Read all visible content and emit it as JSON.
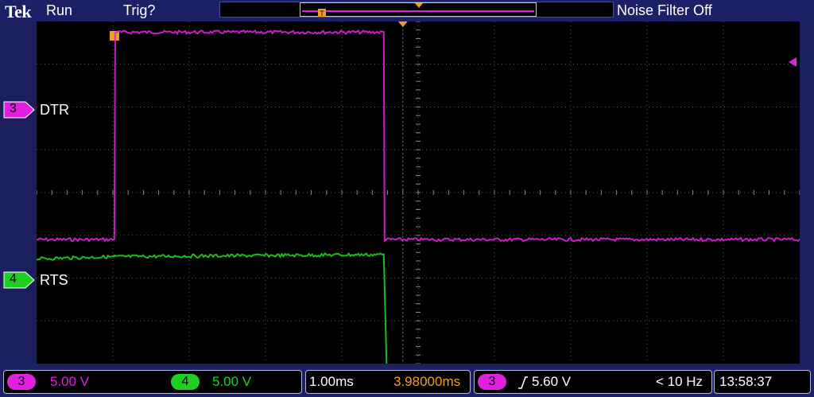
{
  "header": {
    "brand": "Tek",
    "acq_state": "Run",
    "trigger_status": "Trig?",
    "noise_filter": "Noise Filter Off"
  },
  "channels": [
    {
      "number": "3",
      "label": "DTR",
      "color": "#e020e0",
      "scale": "5.00 V"
    },
    {
      "number": "4",
      "label": "RTS",
      "color": "#20d020",
      "scale": "5.00 V"
    }
  ],
  "timebase": {
    "scale": "1.00ms",
    "position": "3.98000ms"
  },
  "trigger": {
    "source": "3",
    "slope_symbol": "/",
    "level": "5.60 V",
    "frequency": "< 10 Hz"
  },
  "clock": "13:58:37",
  "colors": {
    "background": "#1c2066",
    "grid": "#5a5a5a",
    "trigger_marker": "#f0a020",
    "ch3": "#e020e0",
    "ch4": "#20d020"
  },
  "chart_data": {
    "type": "line",
    "xlabel": "",
    "ylabel": "",
    "grid": true,
    "x_divisions": 10,
    "y_divisions": 8,
    "series": [
      {
        "name": "DTR",
        "x_div": [
          0,
          1.02,
          1.03,
          4.55,
          4.56,
          10
        ],
        "y_div": [
          -1.1,
          -1.1,
          3.75,
          3.75,
          -1.1,
          -1.1
        ]
      },
      {
        "name": "RTS",
        "x_div": [
          0,
          1.02,
          4.55,
          4.6,
          10
        ],
        "y_div": [
          -1.55,
          -1.5,
          -1.45,
          -4.95,
          -5.0
        ]
      }
    ]
  }
}
